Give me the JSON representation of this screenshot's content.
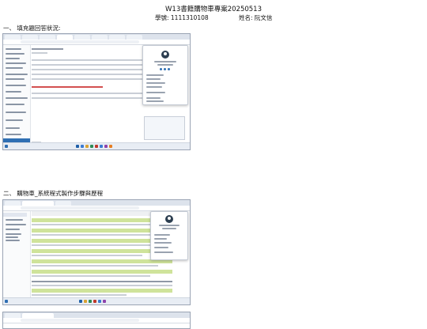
{
  "doc": {
    "title": "W13書籍購物車專案20250513",
    "student_id": "學號: 1111310108",
    "student_name": "姓名: 阮文信"
  },
  "sections": [
    {
      "label": "一、 填充題回答狀況:"
    },
    {
      "label": "二、 購物車_系統程式製作步驟與歷程"
    }
  ],
  "colors": {
    "accent": "#2f6fb3",
    "highlight": "#cfe39b",
    "alert": "#d35050"
  }
}
